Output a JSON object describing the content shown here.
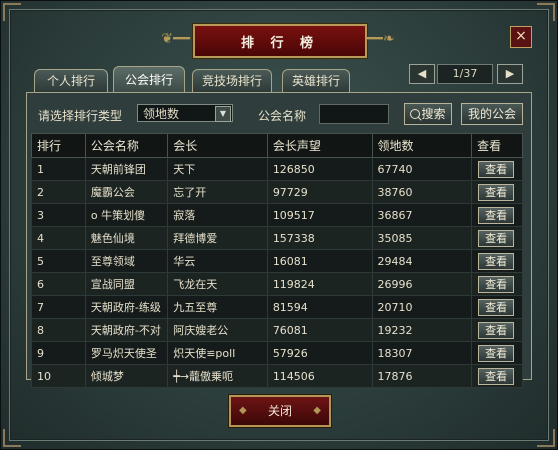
{
  "window": {
    "title": "排 行 榜",
    "close_symbol": "×"
  },
  "tabs": [
    {
      "label": "个人排行",
      "active": false
    },
    {
      "label": "公会排行",
      "active": true
    },
    {
      "label": "竞技场排行",
      "active": false
    },
    {
      "label": "英雄排行",
      "active": false
    }
  ],
  "pager": {
    "prev_symbol": "◀",
    "next_symbol": "▶",
    "page_text": "1/37"
  },
  "filter": {
    "type_label": "请选择排行类型",
    "type_selected": "领地数",
    "guild_name_label": "公会名称",
    "guild_name_value": "",
    "search_label": "搜索",
    "my_guild_label": "我的公会"
  },
  "table": {
    "headers": [
      "排行",
      "公会名称",
      "会长",
      "会长声望",
      "领地数",
      "查看"
    ],
    "rows": [
      {
        "rank": "1",
        "guild": "天朝前锋团",
        "leader": "天下",
        "prestige": "126850",
        "territory": "67740",
        "view": "查看"
      },
      {
        "rank": "2",
        "guild": "魔霸公会",
        "leader": "忘了开",
        "prestige": "97729",
        "territory": "38760",
        "view": "查看"
      },
      {
        "rank": "3",
        "guild": "o 牛策划傻",
        "leader": "寂落",
        "prestige": "109517",
        "territory": "36867",
        "view": "查看"
      },
      {
        "rank": "4",
        "guild": "魅色仙境",
        "leader": "拜德博爱",
        "prestige": "157338",
        "territory": "35085",
        "view": "查看"
      },
      {
        "rank": "5",
        "guild": "至尊领域",
        "leader": "华云",
        "prestige": "16081",
        "territory": "29484",
        "view": "查看"
      },
      {
        "rank": "6",
        "guild": "宣战同盟",
        "leader": "飞龙在天",
        "prestige": "119824",
        "territory": "26996",
        "view": "查看"
      },
      {
        "rank": "7",
        "guild": "天朝政府-练级",
        "leader": "九五至尊",
        "prestige": "81594",
        "territory": "20710",
        "view": "查看"
      },
      {
        "rank": "8",
        "guild": "天朝政府-不对",
        "leader": "阿庆嫂老公",
        "prestige": "76081",
        "territory": "19232",
        "view": "查看"
      },
      {
        "rank": "9",
        "guild": "罗马炽天使圣",
        "leader": "炽天使≌poll",
        "prestige": "57926",
        "territory": "18307",
        "view": "查看"
      },
      {
        "rank": "10",
        "guild": "倾城梦",
        "leader": "┿→蘢傲乗呃",
        "prestige": "114506",
        "territory": "17876",
        "view": "查看"
      }
    ]
  },
  "footer": {
    "close_label": "关闭"
  }
}
